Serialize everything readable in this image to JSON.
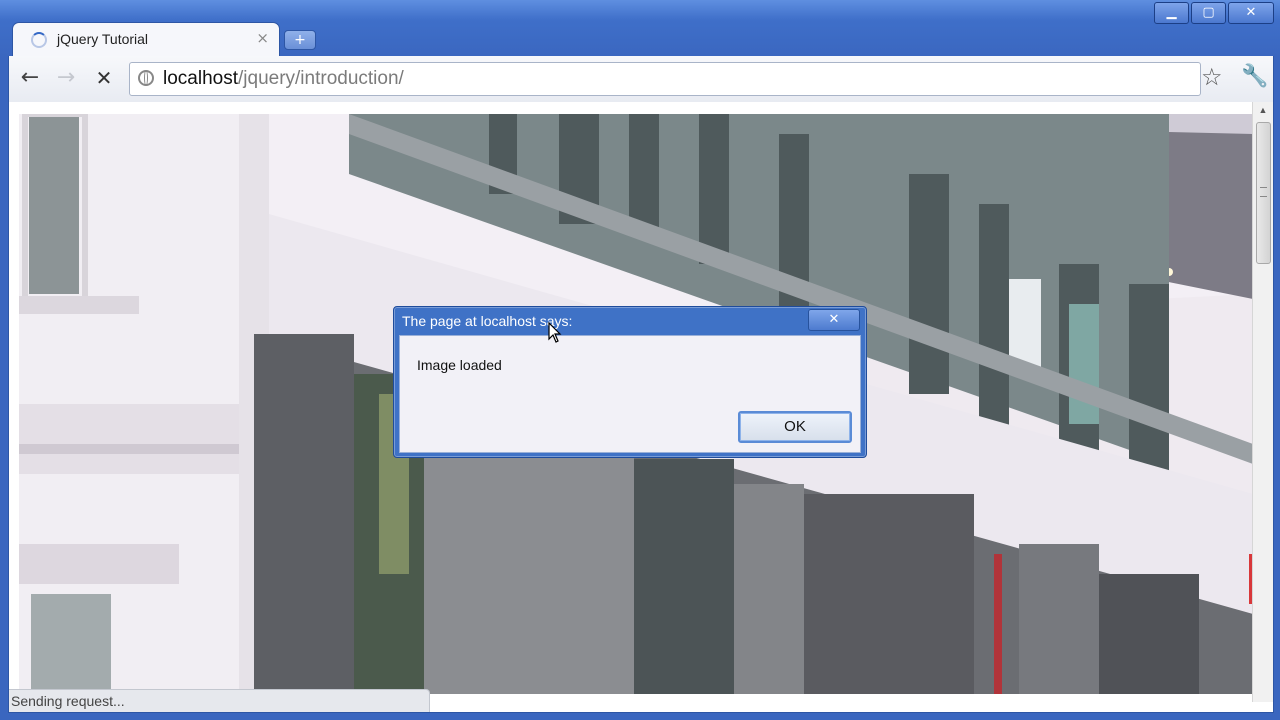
{
  "window": {
    "controls": {
      "minimize": "▁",
      "maximize": "▢",
      "close": "✕"
    }
  },
  "tab": {
    "title": "jQuery Tutorial",
    "close": "×",
    "new_tab": "+"
  },
  "toolbar": {
    "back": "←",
    "forward": "→",
    "stop": "✕",
    "url_host": "localhost",
    "url_path": "/jquery/introduction/",
    "star": "☆",
    "wrench": "🔧"
  },
  "status": {
    "text": "Sending request..."
  },
  "dialog": {
    "title": "The page at localhost says:",
    "close": "✕",
    "message": "Image loaded",
    "ok_label": "OK"
  },
  "colors": {
    "frame": "#3f6fc3",
    "dialog_title_bar": "#3f72c6",
    "dialog_body": "#f2f1f7"
  }
}
